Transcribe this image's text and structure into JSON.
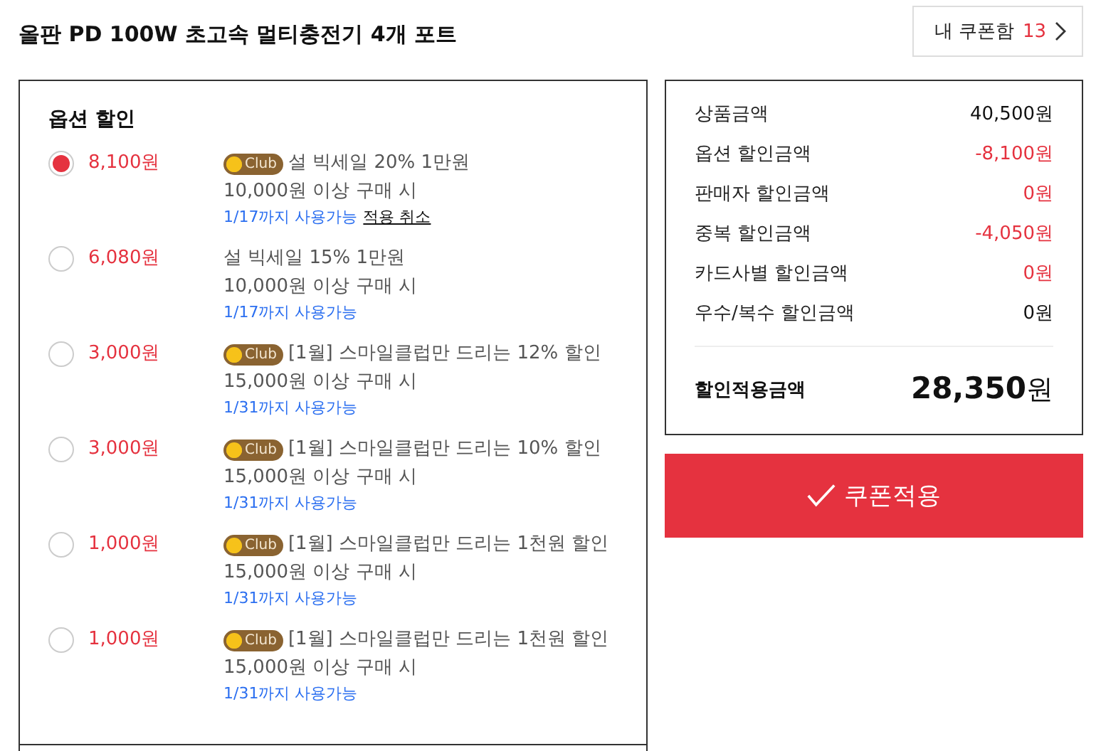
{
  "header": {
    "title": "올판 PD 100W 초고속 멀티충전기 4개 포트",
    "coupon_box": {
      "label": "내 쿠폰함",
      "count": "13"
    }
  },
  "option_discount": {
    "heading": "옵션 할인",
    "coupons": [
      {
        "selected": true,
        "amount": "8,100원",
        "badge": "Club",
        "title": "설 빅세일 20% 1만원",
        "condition": "10,000원 이상 구매 시",
        "expiry": "1/17까지 사용가능",
        "cancel_link": "적용 취소"
      },
      {
        "selected": false,
        "amount": "6,080원",
        "title": "설 빅세일 15% 1만원",
        "condition": "10,000원 이상 구매 시",
        "expiry": "1/17까지 사용가능"
      },
      {
        "selected": false,
        "amount": "3,000원",
        "badge": "Club",
        "title": "[1월] 스마일클럽만 드리는 12% 할인",
        "condition": "15,000원 이상 구매 시",
        "expiry": "1/31까지 사용가능"
      },
      {
        "selected": false,
        "amount": "3,000원",
        "badge": "Club",
        "title": "[1월] 스마일클럽만 드리는 10% 할인",
        "condition": "15,000원 이상 구매 시",
        "expiry": "1/31까지 사용가능"
      },
      {
        "selected": false,
        "amount": "1,000원",
        "badge": "Club",
        "title": "[1월] 스마일클럽만 드리는 1천원 할인",
        "condition": "15,000원 이상 구매 시",
        "expiry": "1/31까지 사용가능"
      },
      {
        "selected": false,
        "amount": "1,000원",
        "badge": "Club",
        "title": "[1월] 스마일클럽만 드리는 1천원 할인",
        "condition": "15,000원 이상 구매 시",
        "expiry": "1/31까지 사용가능"
      }
    ]
  },
  "summary": {
    "rows": [
      {
        "label": "상품금액",
        "value": "40,500원",
        "color": "#111111"
      },
      {
        "label": "옵션 할인금액",
        "value": "-8,100원",
        "color": "#e5323f"
      },
      {
        "label": "판매자 할인금액",
        "value": "0원",
        "color": "#e5323f"
      },
      {
        "label": "중복 할인금액",
        "value": "-4,050원",
        "color": "#e5323f"
      },
      {
        "label": "카드사별 할인금액",
        "value": "0원",
        "color": "#e5323f"
      },
      {
        "label": "우수/복수 할인금액",
        "value": "0원",
        "color": "#111111"
      }
    ],
    "total": {
      "label": "할인적용금액",
      "amount": "28,350",
      "unit": "원"
    }
  },
  "apply_button": {
    "label": "쿠폰적용"
  }
}
